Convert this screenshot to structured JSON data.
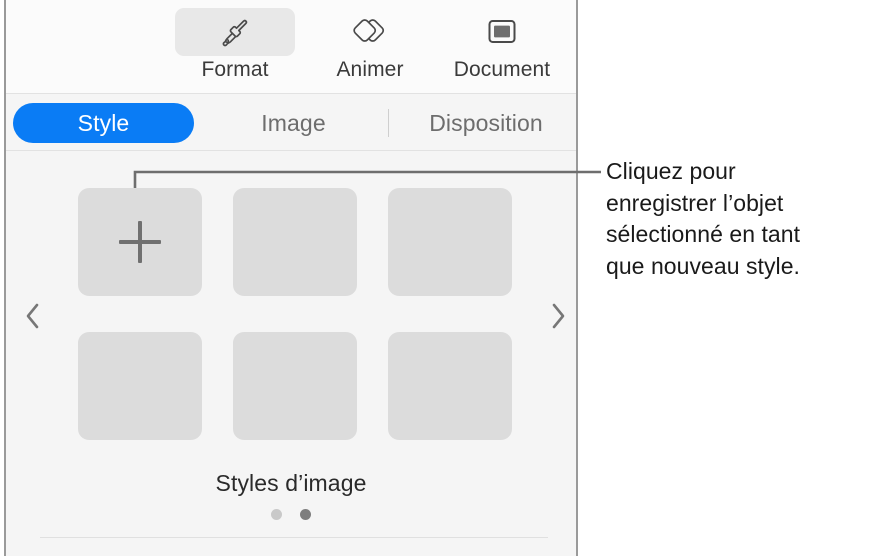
{
  "panel": {
    "toolbar": {
      "tabs": [
        {
          "id": "format",
          "label": "Format",
          "icon": "paintbrush-icon",
          "active": true
        },
        {
          "id": "animer",
          "label": "Animer",
          "icon": "diamonds-icon",
          "active": false
        },
        {
          "id": "document",
          "label": "Document",
          "icon": "document-icon",
          "active": false
        }
      ]
    },
    "segmented_control": {
      "options": [
        {
          "id": "style",
          "label": "Style",
          "selected": true
        },
        {
          "id": "image",
          "label": "Image",
          "selected": false
        },
        {
          "id": "disposition",
          "label": "Disposition",
          "selected": false
        }
      ]
    },
    "styles_grid": {
      "caption": "Styles d’image",
      "add_style_icon": "plus-icon",
      "prev_icon": "chevron-left-icon",
      "next_icon": "chevron-right-icon",
      "swatches": [
        {
          "id": "swatch-add",
          "is_add_button": true
        },
        {
          "id": "swatch-2",
          "is_add_button": false
        },
        {
          "id": "swatch-3",
          "is_add_button": false
        },
        {
          "id": "swatch-4",
          "is_add_button": false
        },
        {
          "id": "swatch-5",
          "is_add_button": false
        },
        {
          "id": "swatch-6",
          "is_add_button": false
        }
      ],
      "page_dots": [
        {
          "index": 1,
          "active": false
        },
        {
          "index": 2,
          "active": true
        }
      ]
    }
  },
  "callout": {
    "text": "Cliquez pour enregistrer l’objet sélectionné en tant que nouveau style.",
    "lines": [
      "Cliquez pour",
      "enregistrer l’objet",
      "sélectionné en tant",
      "que nouveau style."
    ],
    "line_color": "#6e6e6e"
  },
  "colors": {
    "accent": "#0a7cf5",
    "panel_background": "#f5f5f5",
    "toolbar_background": "#fbfbfb",
    "swatch": "#dcdcdc",
    "text": "#1a1a1a"
  }
}
